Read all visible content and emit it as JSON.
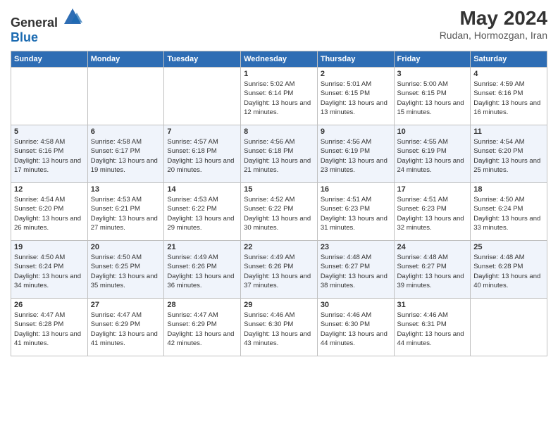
{
  "header": {
    "logo_general": "General",
    "logo_blue": "Blue",
    "month_year": "May 2024",
    "location": "Rudan, Hormozgan, Iran"
  },
  "weekdays": [
    "Sunday",
    "Monday",
    "Tuesday",
    "Wednesday",
    "Thursday",
    "Friday",
    "Saturday"
  ],
  "rows": [
    [
      {
        "day": "",
        "info": ""
      },
      {
        "day": "",
        "info": ""
      },
      {
        "day": "",
        "info": ""
      },
      {
        "day": "1",
        "info": "Sunrise: 5:02 AM\nSunset: 6:14 PM\nDaylight: 13 hours and 12 minutes."
      },
      {
        "day": "2",
        "info": "Sunrise: 5:01 AM\nSunset: 6:15 PM\nDaylight: 13 hours and 13 minutes."
      },
      {
        "day": "3",
        "info": "Sunrise: 5:00 AM\nSunset: 6:15 PM\nDaylight: 13 hours and 15 minutes."
      },
      {
        "day": "4",
        "info": "Sunrise: 4:59 AM\nSunset: 6:16 PM\nDaylight: 13 hours and 16 minutes."
      }
    ],
    [
      {
        "day": "5",
        "info": "Sunrise: 4:58 AM\nSunset: 6:16 PM\nDaylight: 13 hours and 17 minutes."
      },
      {
        "day": "6",
        "info": "Sunrise: 4:58 AM\nSunset: 6:17 PM\nDaylight: 13 hours and 19 minutes."
      },
      {
        "day": "7",
        "info": "Sunrise: 4:57 AM\nSunset: 6:18 PM\nDaylight: 13 hours and 20 minutes."
      },
      {
        "day": "8",
        "info": "Sunrise: 4:56 AM\nSunset: 6:18 PM\nDaylight: 13 hours and 21 minutes."
      },
      {
        "day": "9",
        "info": "Sunrise: 4:56 AM\nSunset: 6:19 PM\nDaylight: 13 hours and 23 minutes."
      },
      {
        "day": "10",
        "info": "Sunrise: 4:55 AM\nSunset: 6:19 PM\nDaylight: 13 hours and 24 minutes."
      },
      {
        "day": "11",
        "info": "Sunrise: 4:54 AM\nSunset: 6:20 PM\nDaylight: 13 hours and 25 minutes."
      }
    ],
    [
      {
        "day": "12",
        "info": "Sunrise: 4:54 AM\nSunset: 6:20 PM\nDaylight: 13 hours and 26 minutes."
      },
      {
        "day": "13",
        "info": "Sunrise: 4:53 AM\nSunset: 6:21 PM\nDaylight: 13 hours and 27 minutes."
      },
      {
        "day": "14",
        "info": "Sunrise: 4:53 AM\nSunset: 6:22 PM\nDaylight: 13 hours and 29 minutes."
      },
      {
        "day": "15",
        "info": "Sunrise: 4:52 AM\nSunset: 6:22 PM\nDaylight: 13 hours and 30 minutes."
      },
      {
        "day": "16",
        "info": "Sunrise: 4:51 AM\nSunset: 6:23 PM\nDaylight: 13 hours and 31 minutes."
      },
      {
        "day": "17",
        "info": "Sunrise: 4:51 AM\nSunset: 6:23 PM\nDaylight: 13 hours and 32 minutes."
      },
      {
        "day": "18",
        "info": "Sunrise: 4:50 AM\nSunset: 6:24 PM\nDaylight: 13 hours and 33 minutes."
      }
    ],
    [
      {
        "day": "19",
        "info": "Sunrise: 4:50 AM\nSunset: 6:24 PM\nDaylight: 13 hours and 34 minutes."
      },
      {
        "day": "20",
        "info": "Sunrise: 4:50 AM\nSunset: 6:25 PM\nDaylight: 13 hours and 35 minutes."
      },
      {
        "day": "21",
        "info": "Sunrise: 4:49 AM\nSunset: 6:26 PM\nDaylight: 13 hours and 36 minutes."
      },
      {
        "day": "22",
        "info": "Sunrise: 4:49 AM\nSunset: 6:26 PM\nDaylight: 13 hours and 37 minutes."
      },
      {
        "day": "23",
        "info": "Sunrise: 4:48 AM\nSunset: 6:27 PM\nDaylight: 13 hours and 38 minutes."
      },
      {
        "day": "24",
        "info": "Sunrise: 4:48 AM\nSunset: 6:27 PM\nDaylight: 13 hours and 39 minutes."
      },
      {
        "day": "25",
        "info": "Sunrise: 4:48 AM\nSunset: 6:28 PM\nDaylight: 13 hours and 40 minutes."
      }
    ],
    [
      {
        "day": "26",
        "info": "Sunrise: 4:47 AM\nSunset: 6:28 PM\nDaylight: 13 hours and 41 minutes."
      },
      {
        "day": "27",
        "info": "Sunrise: 4:47 AM\nSunset: 6:29 PM\nDaylight: 13 hours and 41 minutes."
      },
      {
        "day": "28",
        "info": "Sunrise: 4:47 AM\nSunset: 6:29 PM\nDaylight: 13 hours and 42 minutes."
      },
      {
        "day": "29",
        "info": "Sunrise: 4:46 AM\nSunset: 6:30 PM\nDaylight: 13 hours and 43 minutes."
      },
      {
        "day": "30",
        "info": "Sunrise: 4:46 AM\nSunset: 6:30 PM\nDaylight: 13 hours and 44 minutes."
      },
      {
        "day": "31",
        "info": "Sunrise: 4:46 AM\nSunset: 6:31 PM\nDaylight: 13 hours and 44 minutes."
      },
      {
        "day": "",
        "info": ""
      }
    ]
  ]
}
